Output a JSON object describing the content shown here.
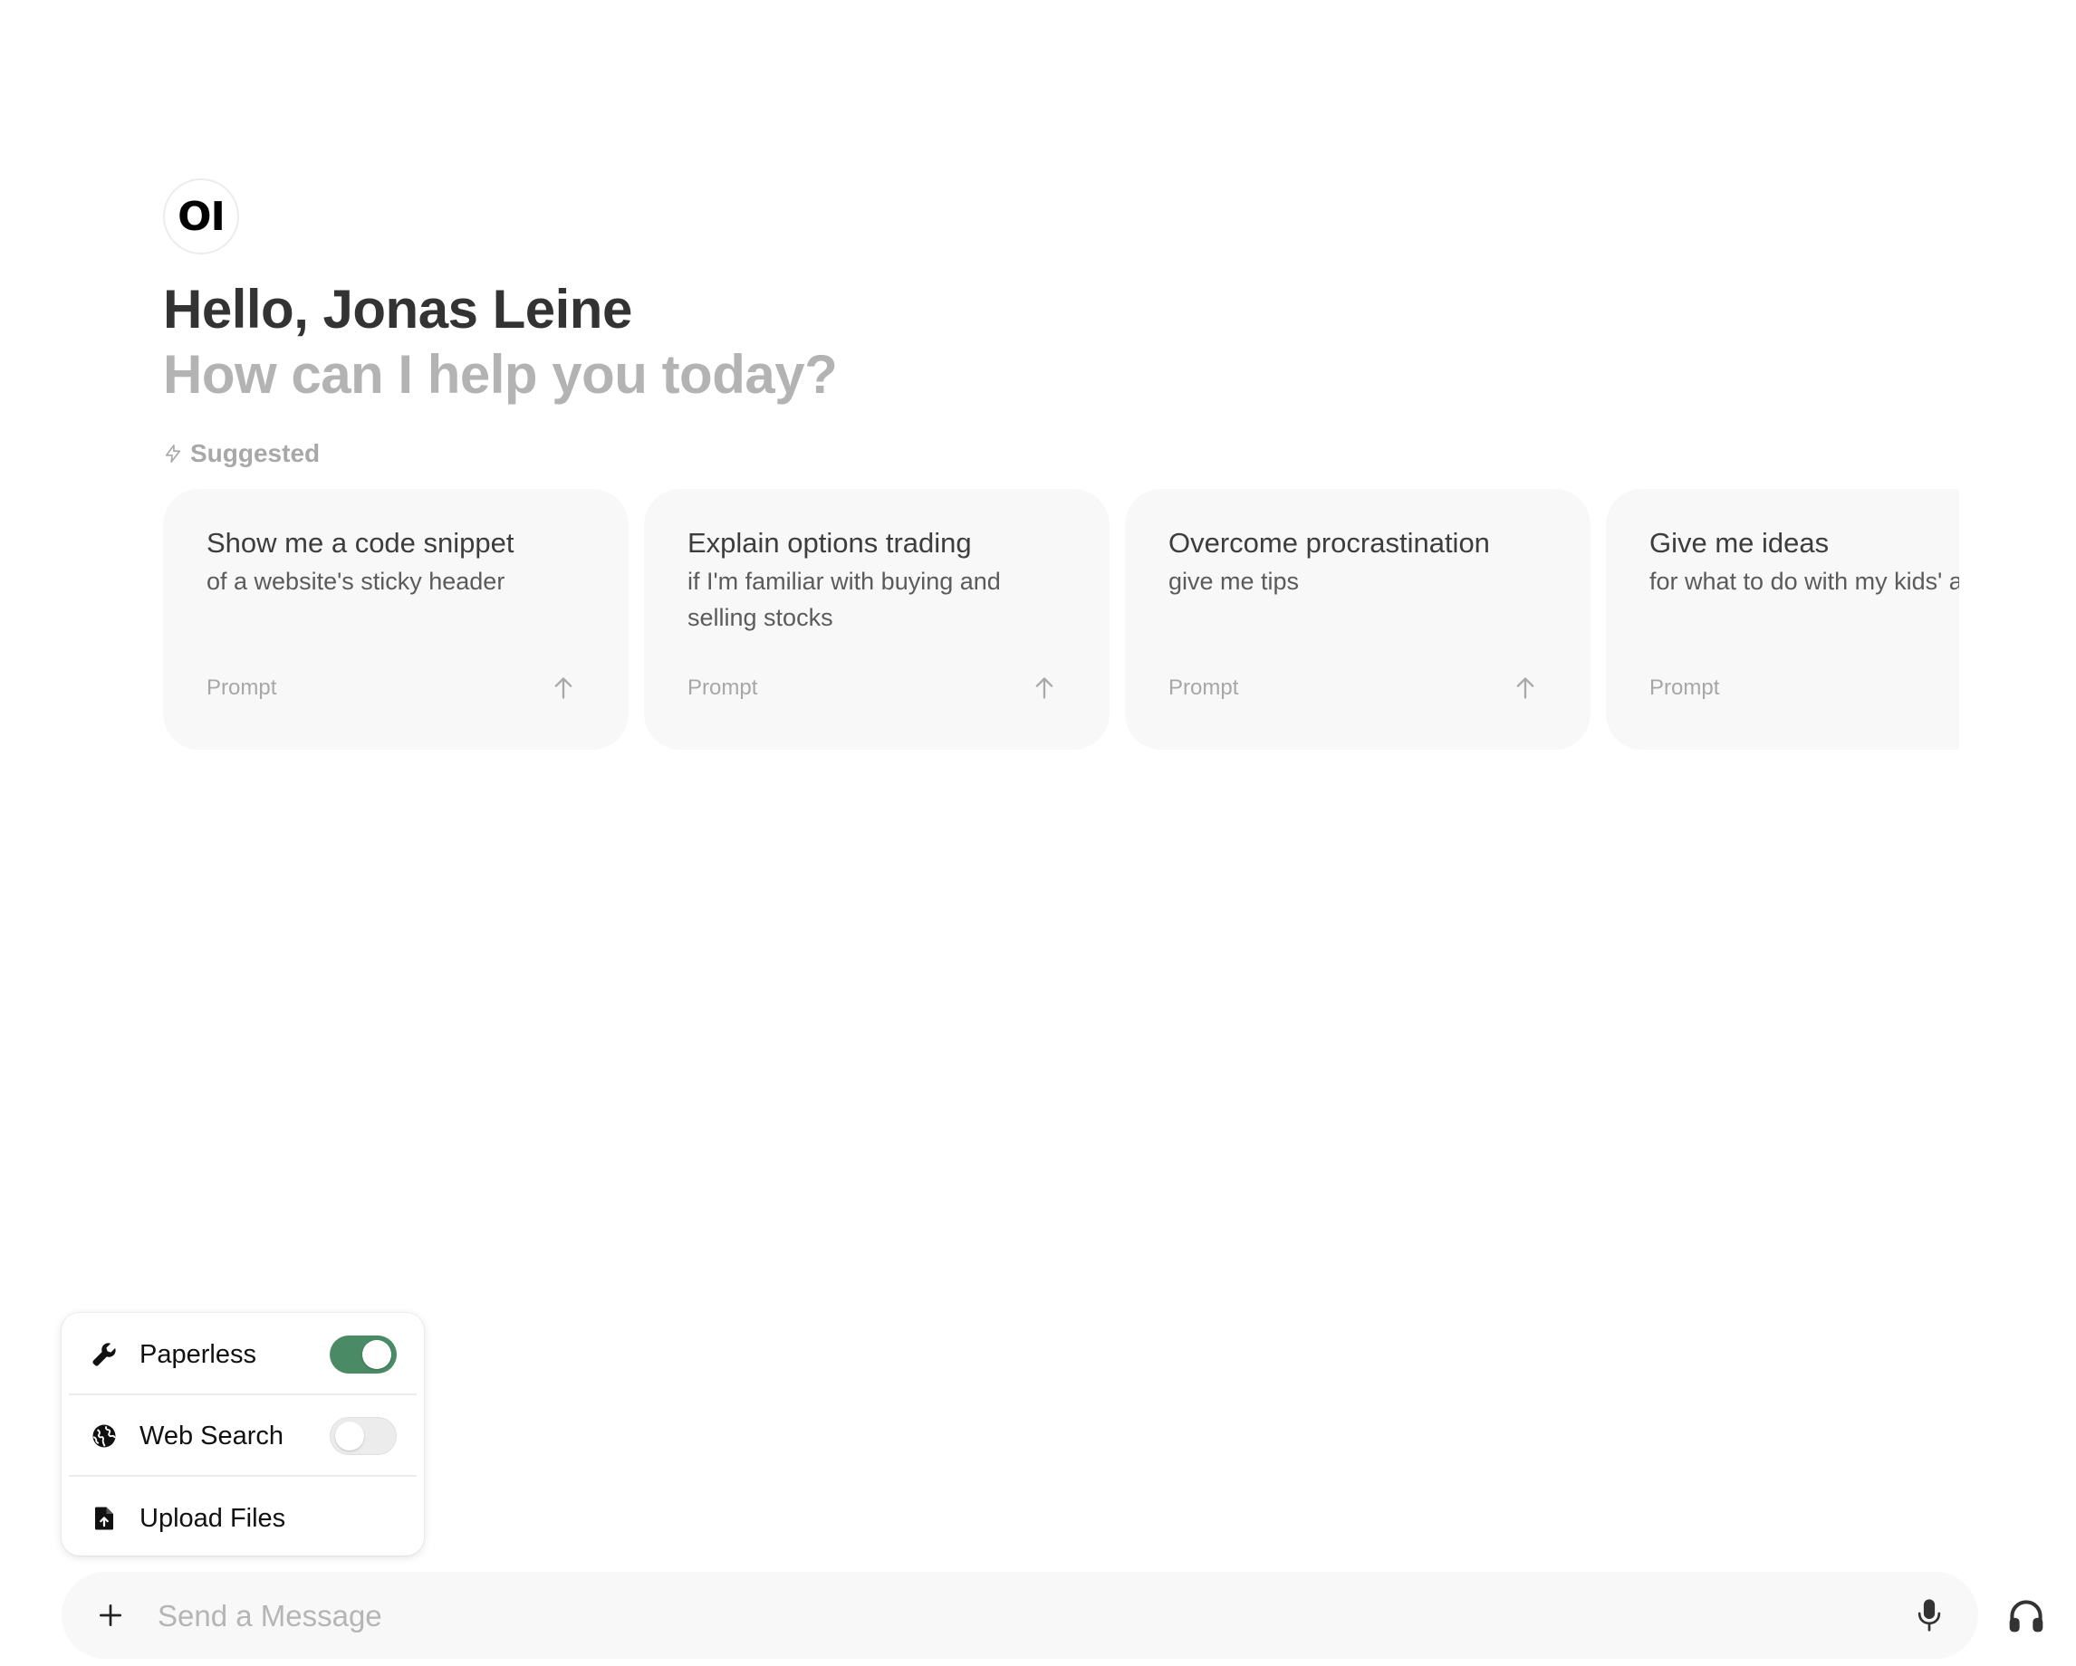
{
  "logo": {
    "text": "OI"
  },
  "greeting": "Hello, Jonas Leine",
  "subtitle": "How can I help you today?",
  "suggested": {
    "label": "Suggested",
    "icon": "bolt-icon"
  },
  "cards": [
    {
      "title": "Show me a code snippet",
      "subtitle": "of a website's sticky header",
      "footer": "Prompt"
    },
    {
      "title": "Explain options trading",
      "subtitle": "if I'm familiar with buying and selling stocks",
      "footer": "Prompt"
    },
    {
      "title": "Overcome procrastination",
      "subtitle": "give me tips",
      "footer": "Prompt"
    },
    {
      "title": "Give me ideas",
      "subtitle": "for what to do with my kids' art",
      "footer": "Prompt"
    }
  ],
  "tools": [
    {
      "label": "Paperless",
      "icon": "wrench-icon",
      "toggle": true
    },
    {
      "label": "Web Search",
      "icon": "globe-icon",
      "toggle": false
    },
    {
      "label": "Upload Files",
      "icon": "file-upload-icon"
    }
  ],
  "input": {
    "placeholder": "Send a Message",
    "value": ""
  },
  "colors": {
    "toggle_on": "#4a8a64",
    "card_bg": "#f8f8f8",
    "muted_text": "#b3b3b3"
  }
}
